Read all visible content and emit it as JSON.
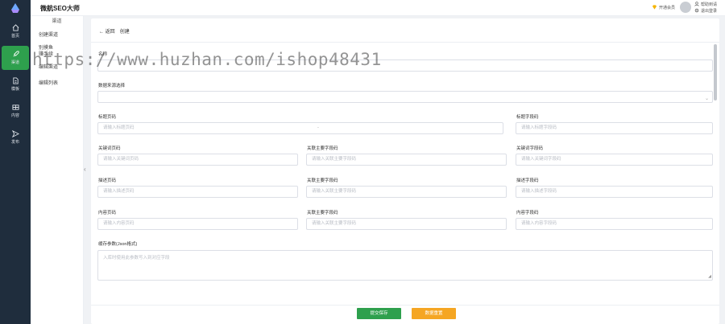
{
  "app": {
    "brand": "微航SEO大师"
  },
  "header": {
    "vip_label": "开通会员",
    "user_links": [
      "帮助到请",
      "退出登录"
    ]
  },
  "leftbar": {
    "items": [
      {
        "label": "首页",
        "icon": "home-icon"
      },
      {
        "label": "渠道",
        "icon": "rocket-icon"
      },
      {
        "label": "模板",
        "icon": "document-icon"
      },
      {
        "label": "内容",
        "icon": "grid-icon"
      },
      {
        "label": "发布",
        "icon": "send-icon"
      }
    ],
    "active_index": 1
  },
  "subnav": {
    "head": "渠道",
    "items": [
      "创建渠道",
      "别摸鱼",
      "赚手续",
      "编辑渠道",
      "编辑列表"
    ]
  },
  "breadcrumb": {
    "back": "返回",
    "current": "创建"
  },
  "form": {
    "name": {
      "label": "名称",
      "placeholder": ""
    },
    "select": {
      "label": "数据来源选择",
      "value": ""
    },
    "row1": {
      "left": {
        "label": "标题页码",
        "placeholder": "请输入标题页码"
      },
      "middle_hint": "-",
      "right": {
        "label": "标题字段码",
        "placeholder": "请输入标题字段码"
      }
    },
    "row2": {
      "left": {
        "label": "关键词页码",
        "placeholder": "请输入关键词页码"
      },
      "middle": {
        "label": "关联主要字段码",
        "placeholder": "请输入关联主要字段码"
      },
      "right": {
        "label": "关键词字段码",
        "placeholder": "请输入关键词字段码"
      }
    },
    "row3": {
      "left": {
        "label": "描述页码",
        "placeholder": "请输入描述页码"
      },
      "middle": {
        "label": "关联主要字段码",
        "placeholder": "请输入关联主要字段码"
      },
      "right": {
        "label": "描述字段码",
        "placeholder": "请输入描述字段码"
      }
    },
    "row4": {
      "left": {
        "label": "内容页码",
        "placeholder": "请输入内容页码"
      },
      "middle": {
        "label": "关联主要字段码",
        "placeholder": "请输入关联主要字段码"
      },
      "right": {
        "label": "内容字段码",
        "placeholder": "请输入内容字段码"
      }
    },
    "json": {
      "label": "缓存参数(Json格式)",
      "placeholder": "入库时使用此参数写入到对应字段"
    }
  },
  "buttons": {
    "submit": "提交保存",
    "reset": "数据重置"
  },
  "watermark": "https://www.huzhan.com/ishop48431",
  "colors": {
    "sidebar": "#1f2d3d",
    "accent": "#2ea04d",
    "warn": "#f5a623"
  }
}
